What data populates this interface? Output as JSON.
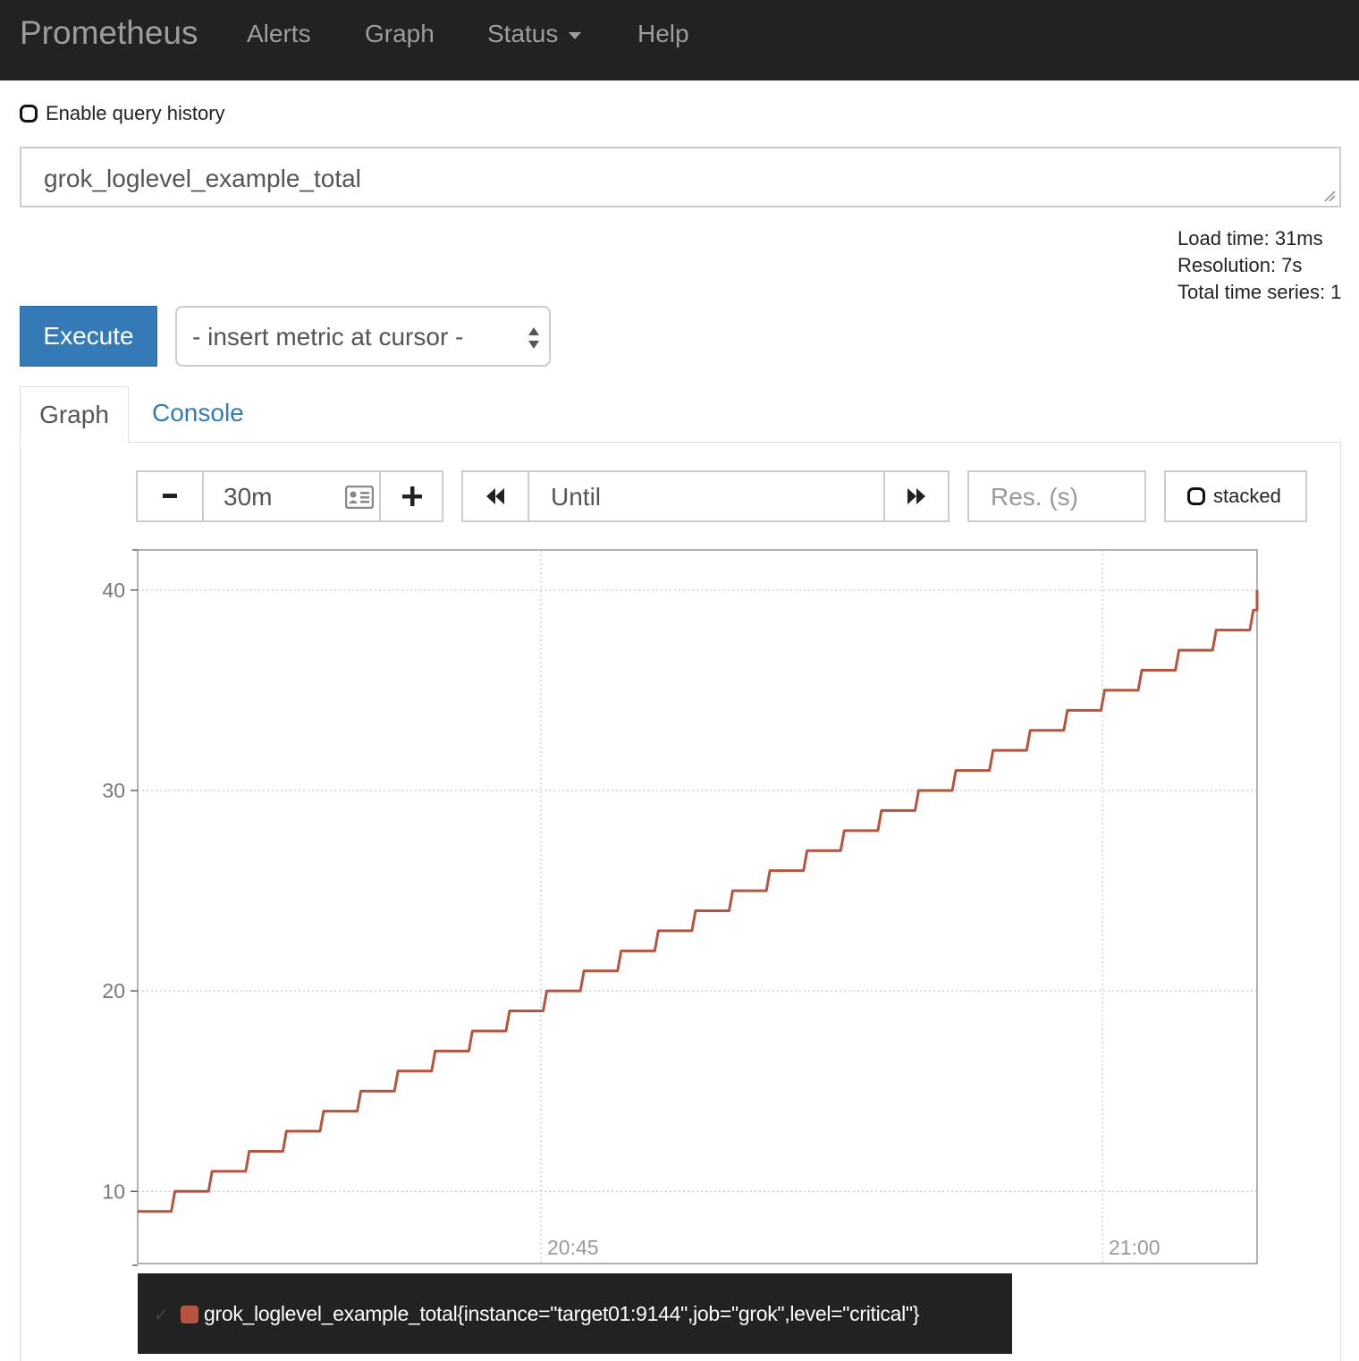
{
  "navbar": {
    "brand": "Prometheus",
    "items": [
      "Alerts",
      "Graph",
      "Status",
      "Help"
    ]
  },
  "history": {
    "label": "Enable query history",
    "checked": false
  },
  "expression": {
    "value": "grok_loglevel_example_total"
  },
  "stats": {
    "load_time": "Load time: 31ms",
    "resolution": "Resolution: 7s",
    "total_series": "Total time series: 1"
  },
  "execute": {
    "label": "Execute"
  },
  "metric_select": {
    "selected": "- insert metric at cursor -"
  },
  "tabs": {
    "graph": "Graph",
    "console": "Console",
    "active": "Graph"
  },
  "controls": {
    "range": "30m",
    "until_placeholder": "Until",
    "resolution_placeholder": "Res. (s)",
    "stacked_label": "stacked",
    "stacked_checked": false
  },
  "colors": {
    "series": "#b6543f",
    "navbar": "#222222",
    "primary": "#337ab7"
  },
  "chart_data": {
    "type": "line",
    "x_ticks": [
      "20:45",
      "21:00"
    ],
    "y_ticks": [
      10,
      20,
      30,
      40
    ],
    "ylim": [
      6.4,
      42.0
    ],
    "grid": true,
    "series": [
      {
        "name": "grok_loglevel_example_total{instance=\"target01:9144\",job=\"grok\",level=\"critical\"}",
        "step_values": [
          9,
          10,
          11,
          12,
          13,
          14,
          15,
          16,
          17,
          18,
          19,
          20,
          21,
          22,
          23,
          24,
          25,
          26,
          27,
          28,
          29,
          30,
          31,
          32,
          33,
          34,
          35,
          36,
          37,
          38,
          39
        ]
      }
    ]
  },
  "legend": {
    "entry": "grok_loglevel_example_total{instance=\"target01:9144\",job=\"grok\",level=\"critical\"}"
  }
}
